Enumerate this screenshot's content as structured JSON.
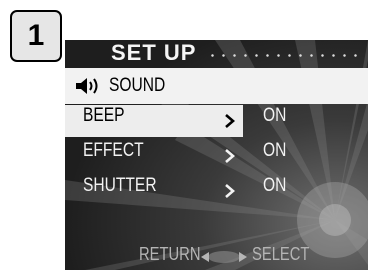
{
  "step_number": "1",
  "screen": {
    "title": "SET UP",
    "header": {
      "icon": "speaker-icon",
      "label": "SOUND"
    },
    "menu_items": [
      {
        "label": "BEEP",
        "value": "ON",
        "selected": true
      },
      {
        "label": "EFFECT",
        "value": "ON",
        "selected": false
      },
      {
        "label": "SHUTTER",
        "value": "ON",
        "selected": false
      }
    ],
    "footer": {
      "return_label": "RETURN",
      "select_label": "SELECT",
      "icon": "left-right-arrows-icon"
    }
  },
  "colors": {
    "screen_background": "#2c2c2c",
    "highlight": "#ededed",
    "menu_text": "#f2f2f2",
    "footer_text": "#b5b5b5"
  }
}
